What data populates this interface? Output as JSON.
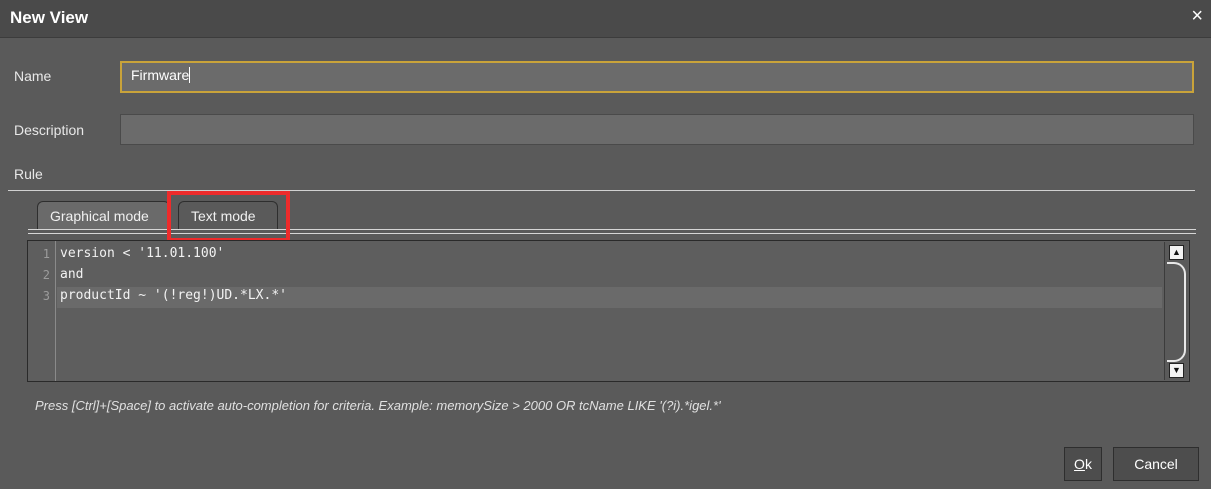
{
  "dialog": {
    "title": "New View",
    "close_icon": "×"
  },
  "form": {
    "name_label": "Name",
    "name_value": "Firmware",
    "description_label": "Description",
    "description_value": "",
    "rule_label": "Rule"
  },
  "tabs": [
    {
      "label": "Graphical mode",
      "selected": false
    },
    {
      "label": "Text mode",
      "selected": true
    }
  ],
  "editor": {
    "lines": [
      {
        "number": "1",
        "text": "version < '11.01.100'"
      },
      {
        "number": "2",
        "text": "and"
      },
      {
        "number": "3",
        "text": "productId ~ '(!reg!)UD.*LX.*'"
      }
    ],
    "scroll_up_icon": "▲",
    "scroll_down_icon": "▼"
  },
  "hint": "Press [Ctrl]+[Space] to activate auto-completion for criteria. Example: memorySize > 2000 OR tcName LIKE '(?i).*igel.*'",
  "buttons": {
    "ok_mnemonic": "O",
    "ok_rest": "k",
    "cancel_label": "Cancel"
  },
  "colors": {
    "highlight": "#ee2b2b",
    "focus_border": "#c9a33a"
  }
}
